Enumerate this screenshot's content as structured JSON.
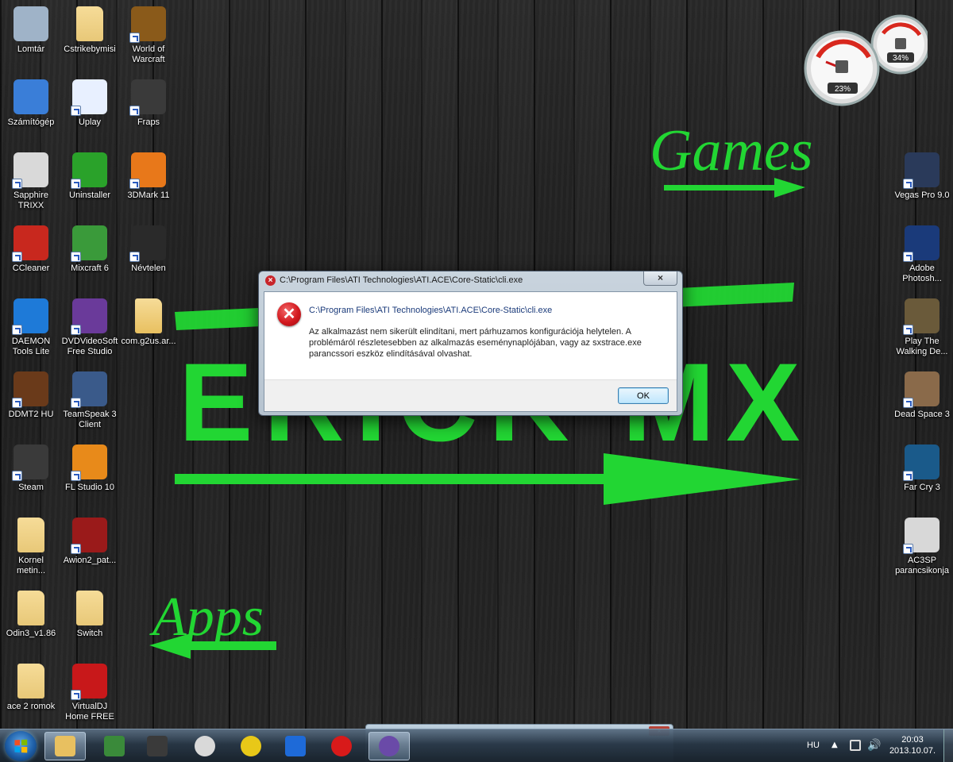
{
  "wallpaper": {
    "games_text": "Games",
    "apps_text": "Apps",
    "name_text": "ERICK MX",
    "accent_color": "#22d633"
  },
  "gadget": {
    "cpu_percent": "23%",
    "ram_percent": "34%"
  },
  "icons_left": [
    {
      "label": "Lomtár",
      "icon": "recycle-bin-icon",
      "color": "#9fb3c8"
    },
    {
      "label": "Cstrikebymisi",
      "icon": "folder-icon",
      "color": "#e8c878"
    },
    {
      "label": "World of\nWarcraft",
      "icon": "wow-icon",
      "color": "#8a5a1a"
    },
    {
      "label": "Számítógép",
      "icon": "computer-icon",
      "color": "#3a7ed8"
    },
    {
      "label": "Uplay",
      "icon": "uplay-icon",
      "color": "#e8f0ff"
    },
    {
      "label": "Fraps",
      "icon": "fraps-icon",
      "color": "#3a3a3a"
    },
    {
      "label": "Sapphire\nTRIXX",
      "icon": "gauge-icon",
      "color": "#d9d9d9"
    },
    {
      "label": "Uninstaller",
      "icon": "uninstaller-icon",
      "color": "#2aa22a"
    },
    {
      "label": "3DMark 11",
      "icon": "3dmark-icon",
      "color": "#e8781a"
    },
    {
      "label": "CCleaner",
      "icon": "ccleaner-icon",
      "color": "#c8281e"
    },
    {
      "label": "Mixcraft 6",
      "icon": "mixcraft-icon",
      "color": "#3a9a3a"
    },
    {
      "label": "Névtelen",
      "icon": "screen-icon",
      "color": "#2a2a2a"
    },
    {
      "label": "DAEMON\nTools Lite",
      "icon": "daemon-icon",
      "color": "#1e7ad8"
    },
    {
      "label": "DVDVideoSoft\nFree Studio",
      "icon": "fs-icon",
      "color": "#6a3a9a"
    },
    {
      "label": "com.g2us.ar...",
      "icon": "folder-icon",
      "color": "#e8c060"
    },
    {
      "label": "DDMT2 HU",
      "icon": "game-icon",
      "color": "#6a3a1a"
    },
    {
      "label": "TeamSpeak 3\nClient",
      "icon": "teamspeak-icon",
      "color": "#3a5a8a"
    },
    {
      "label": "Steam",
      "icon": "steam-icon",
      "color": "#3a3a3a"
    },
    {
      "label": "FL Studio 10",
      "icon": "flstudio-icon",
      "color": "#e88a1a"
    },
    {
      "label": "Kornel\nmetin...",
      "icon": "folder-icon",
      "color": "#e8c878"
    },
    {
      "label": "Awion2_pat...",
      "icon": "awion-icon",
      "color": "#9a1a1a"
    },
    {
      "label": "Odin3_v1.86",
      "icon": "folder-icon",
      "color": "#e8c878"
    },
    {
      "label": "Switch",
      "icon": "folder-icon",
      "color": "#e8c878"
    },
    {
      "label": "ace 2 romok",
      "icon": "folder-icon",
      "color": "#e8c878"
    },
    {
      "label": "VirtualDJ\nHome FREE",
      "icon": "virtualdj-icon",
      "color": "#c8181a"
    }
  ],
  "icons_right": [
    {
      "label": "Vegas Pro 9.0",
      "icon": "vegas-icon",
      "color": "#2a3a5a"
    },
    {
      "label": "Adobe\nPhotosh...",
      "icon": "photoshop-icon",
      "color": "#1a3a7a"
    },
    {
      "label": "Play The\nWalking De...",
      "icon": "walkingdead-icon",
      "color": "#6a5a3a"
    },
    {
      "label": "Dead Space 3",
      "icon": "deadspace-icon",
      "color": "#8a6a4a"
    },
    {
      "label": "Far Cry 3",
      "icon": "farcry-icon",
      "color": "#1a5a8a"
    },
    {
      "label": "AC3SP\nparancsikonja",
      "icon": "ac3-icon",
      "color": "#d8d8d8"
    }
  ],
  "dialog": {
    "title": "C:\\Program Files\\ATI Technologies\\ATI.ACE\\Core-Static\\cli.exe",
    "close_label": "×",
    "heading": "C:\\Program Files\\ATI Technologies\\ATI.ACE\\Core-Static\\cli.exe",
    "message": "Az alkalmazást nem sikerült elindítani, mert párhuzamos konfigurációja helytelen. A problémáról részletesebben az alkalmazás eseménynaplójában, vagy az sxstrace.exe parancssori eszköz elindításával olvashat.",
    "ok_label": "OK"
  },
  "taskbar": {
    "pinned": [
      {
        "icon": "explorer-icon",
        "color": "#e8c060"
      },
      {
        "icon": "monitor-icon",
        "color": "#3a8a3a"
      },
      {
        "icon": "fraps-icon",
        "color": "#3a3a3a"
      },
      {
        "icon": "gauge-icon",
        "color": "#d9d9d9"
      },
      {
        "icon": "chrome-icon",
        "color": "#e8c818"
      },
      {
        "icon": "maxthon-icon",
        "color": "#1e6ad8"
      },
      {
        "icon": "record-icon",
        "color": "#d81a1a"
      },
      {
        "icon": "bittorrent-icon",
        "color": "#6a4aa8"
      }
    ],
    "language": "HU",
    "time": "20:03",
    "date": "2013.10.07.",
    "preview_close": "×"
  }
}
